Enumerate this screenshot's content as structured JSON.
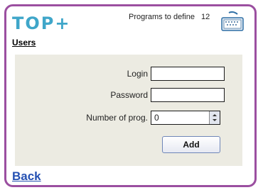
{
  "header": {
    "logo": "TOP+",
    "programs_label": "Programs to define",
    "programs_count": "12",
    "keyboard_icon": "keyboard-icon"
  },
  "nav": {
    "users_link": "Users",
    "back_link": "Back"
  },
  "form": {
    "login_label": "Login",
    "login_value": "",
    "password_label": "Password",
    "password_value": "",
    "num_prog_label": "Number of prog.",
    "num_prog_value": "0",
    "add_button": "Add"
  },
  "colors": {
    "frame": "#9b4fa0",
    "logo": "#3fa6c9",
    "panel": "#ecebe2",
    "link": "#2450b2"
  }
}
